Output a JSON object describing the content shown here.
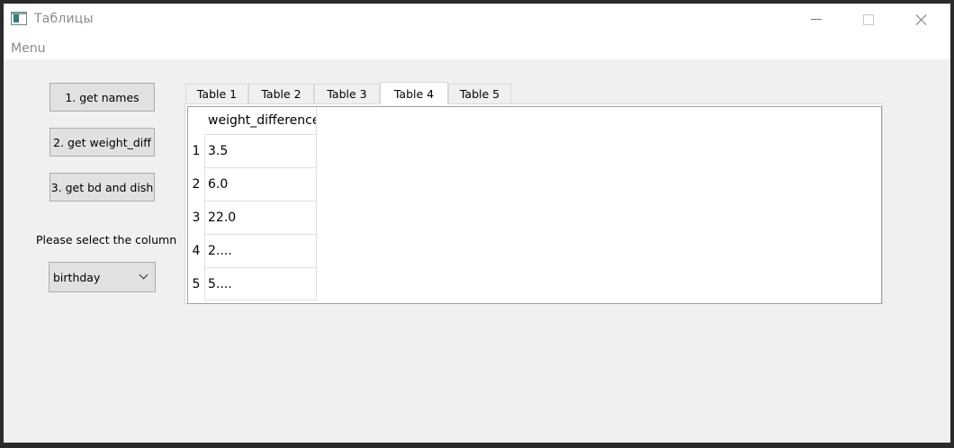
{
  "window": {
    "title": "Таблицы",
    "menu": "Menu"
  },
  "icons": {
    "app": "app-window-icon",
    "minimize": "minimize-icon",
    "maximize": "maximize-icon",
    "close": "close-icon",
    "dropdown": "chevron-down-icon"
  },
  "sidebar": {
    "buttons": [
      "1. get names",
      "2. get weight_diff",
      "3. get bd and dish"
    ],
    "column_label": "Please select the column",
    "column_select": {
      "value": "birthday"
    }
  },
  "tabs": [
    "Table 1",
    "Table 2",
    "Table 3",
    "Table 4",
    "Table 5"
  ],
  "active_tab": "Table 4",
  "table": {
    "column_header": "weight_difference",
    "row_numbers": [
      "1",
      "2",
      "3",
      "4",
      "5"
    ],
    "values": [
      "3.5",
      "6.0",
      "22.0",
      "2....",
      "5...."
    ]
  },
  "colors": {
    "window_bg": "#f0f0f0",
    "titlebar_bg": "#ffffff",
    "button_bg": "#e1e1e1",
    "button_border": "#adadad"
  }
}
